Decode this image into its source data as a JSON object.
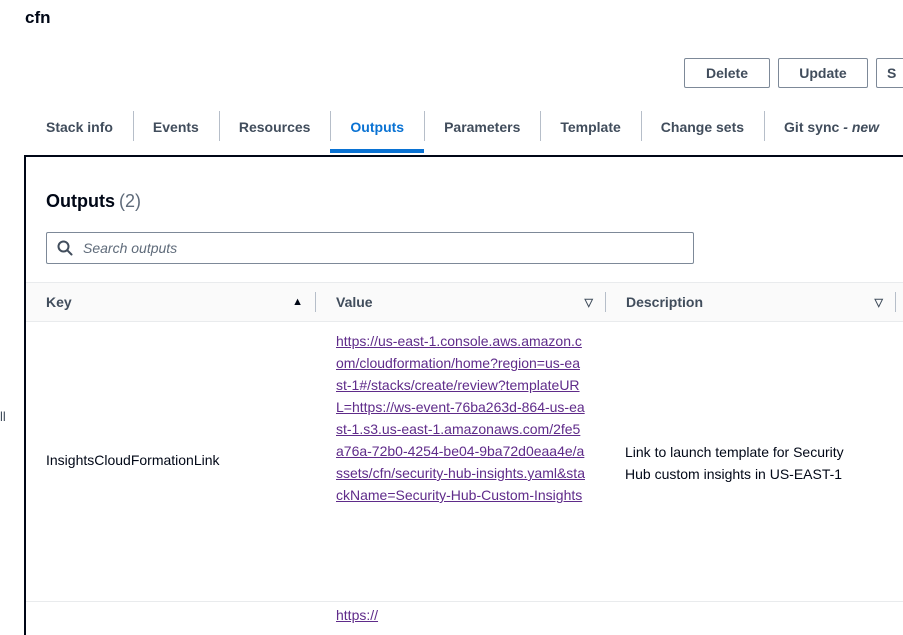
{
  "page": {
    "title": "cfn",
    "side_mark": "ll"
  },
  "actions": {
    "delete_label": "Delete",
    "update_label": "Update",
    "more_label": "S"
  },
  "tabs": [
    {
      "label": "Stack info"
    },
    {
      "label": "Events"
    },
    {
      "label": "Resources"
    },
    {
      "label": "Outputs",
      "active": true
    },
    {
      "label": "Parameters"
    },
    {
      "label": "Template"
    },
    {
      "label": "Change sets"
    },
    {
      "label": "Git sync",
      "suffix": "- new"
    }
  ],
  "outputs": {
    "title": "Outputs",
    "count": "(2)",
    "search_placeholder": "Search outputs",
    "columns": {
      "key": "Key",
      "value": "Value",
      "description": "Description"
    },
    "rows": [
      {
        "key": "InsightsCloudFormationLink",
        "value": "https://us-east-1.console.aws.amazon.com/cloudformation/home?region=us-east-1#/stacks/create/review?templateURL=https://ws-event-76ba263d-864-us-east-1.s3.us-east-1.amazonaws.com/2fe5a76a-72b0-4254-be04-9ba72d0eaa4e/assets/cfn/security-hub-insights.yaml&stackName=Security-Hub-Custom-Insights",
        "description": "Link to launch template for Security Hub custom insights in US-EAST-1"
      }
    ],
    "next_row_fragment": "https://"
  },
  "colors": {
    "accent": "#0972d3",
    "text": "#000716",
    "link_visited": "#5f2b8a",
    "border": "#7d8998"
  }
}
